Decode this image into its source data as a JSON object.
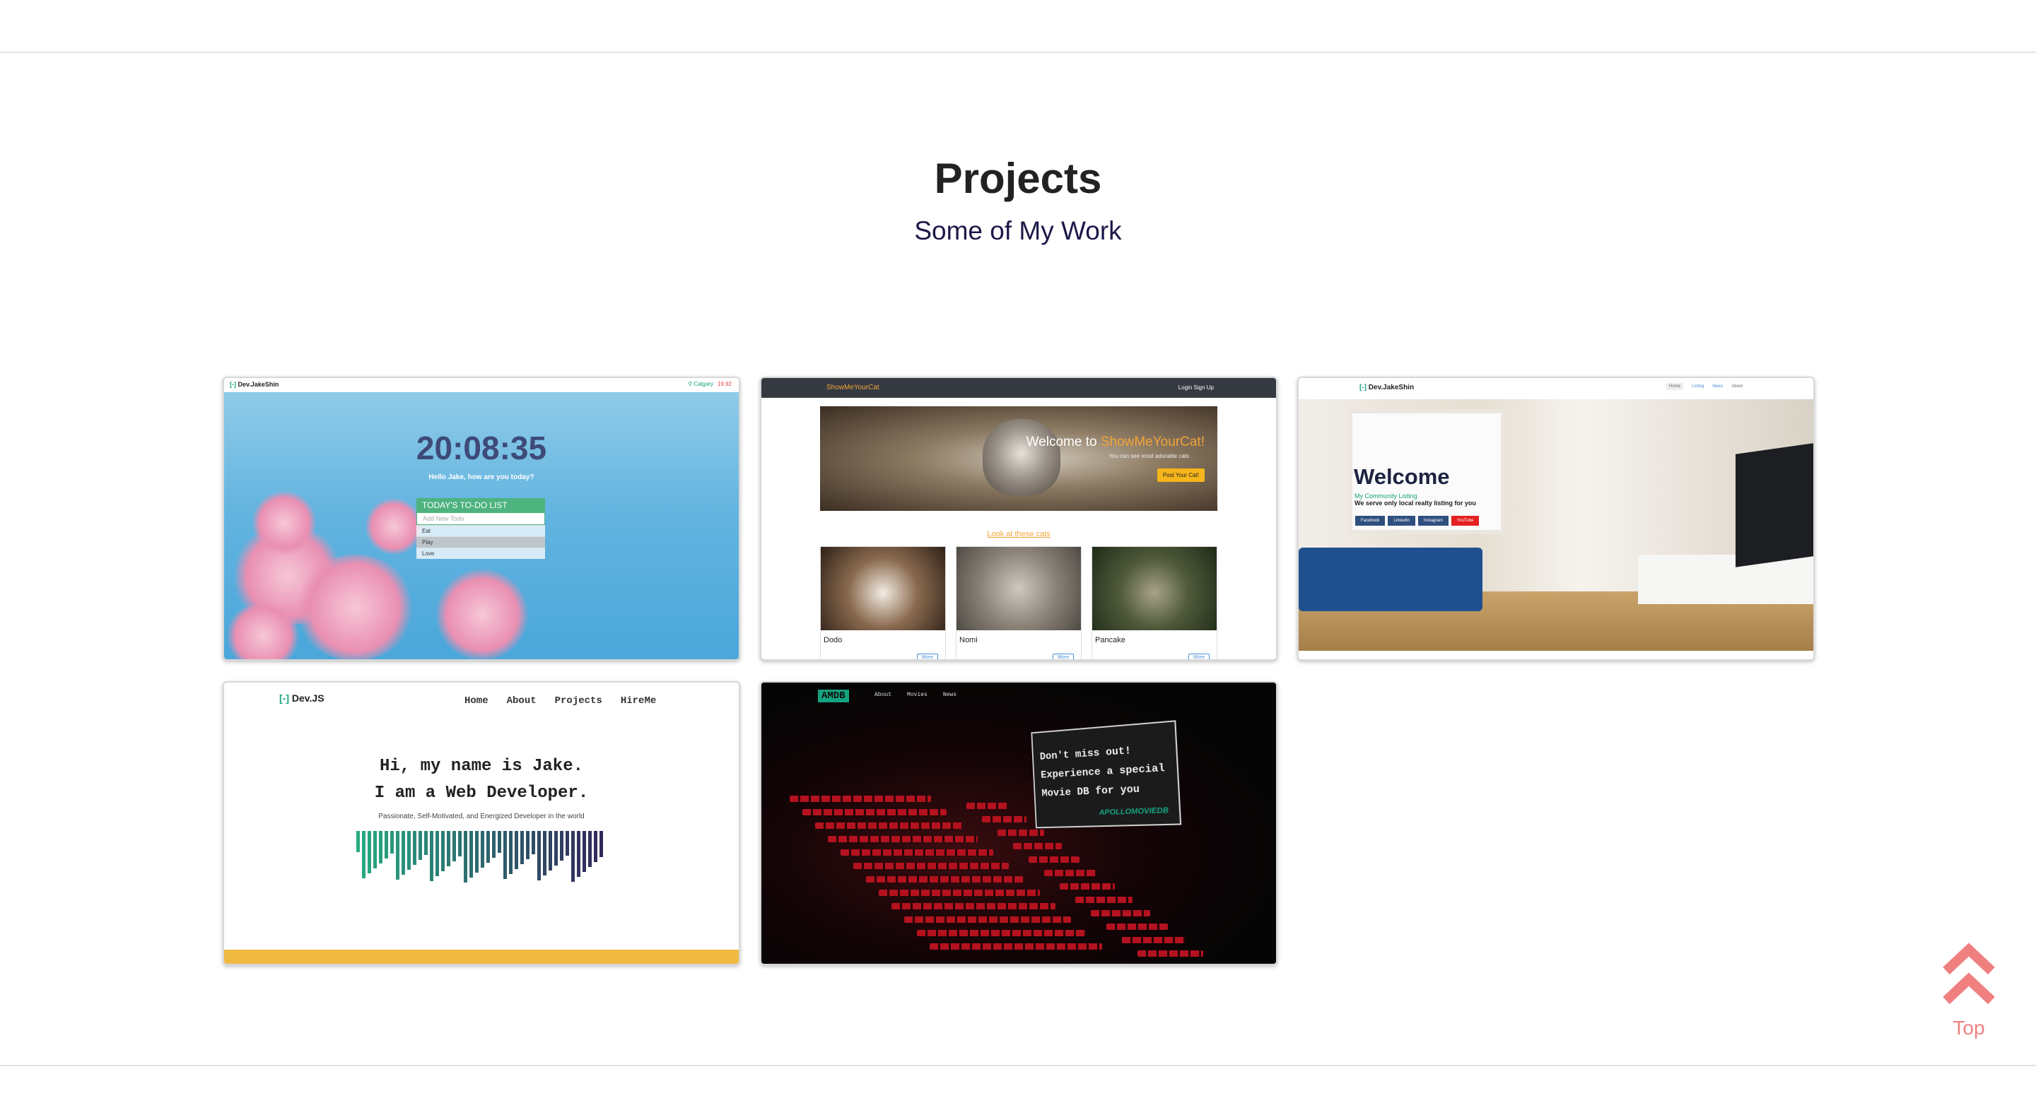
{
  "section": {
    "title": "Projects",
    "subtitle": "Some of My Work"
  },
  "projects": [
    {
      "brand": "Dev.JakeShin",
      "location": "Calgary",
      "temp": "19.92",
      "clock": "20:08:35",
      "greeting": "Hello Jake, how are you today?",
      "todo_title": "TODAY'S TO-DO LIST",
      "todo_placeholder": "Add New Todo",
      "todo_items": [
        "Eat",
        "Play",
        "Love"
      ]
    },
    {
      "brand": "ShowMeYourCat",
      "nav_links": "Login   Sign Up",
      "hero_prefix": "Welcome to ",
      "hero_brand": "ShowMeYourCat!",
      "hero_sub": "You can see most adorable cats",
      "hero_button": "Post Your Cat!",
      "gallery_link": "Look at these cats",
      "cats": [
        "Dodo",
        "Nomi",
        "Pancake"
      ],
      "more_label": "More"
    },
    {
      "brand": "Dev.JakeShin",
      "nav": [
        "Home",
        "Listing",
        "News",
        "About"
      ],
      "welcome": "Welcome",
      "community": "My Community Listing",
      "serve": "We serve only local realty listing for you",
      "socials": [
        "Facebook",
        "LinkedIn",
        "Instagram",
        "YouTube"
      ]
    },
    {
      "brand": "Dev.JS",
      "nav": [
        "Home",
        "About",
        "Projects",
        "HireMe"
      ],
      "line1": "Hi, my name is Jake.",
      "line2": "I am a Web Developer.",
      "tagline": "Passionate, Self-Motivated, and Energized Developer in the world"
    },
    {
      "brand": "AMDB",
      "nav": [
        "About",
        "Movies",
        "News"
      ],
      "screen_line1": "Don't miss out!",
      "screen_line2": "Experience a special",
      "screen_line3": "Movie DB for you",
      "screen_brand": "APOLLOMOVIEDB"
    }
  ],
  "scroll_top": {
    "label": "Top",
    "icon": "double-chevron-up-icon"
  },
  "colors": {
    "accent": "#14a37f",
    "top_button": "#f08080",
    "heading": "#222222",
    "subtitle": "#1b1848"
  }
}
